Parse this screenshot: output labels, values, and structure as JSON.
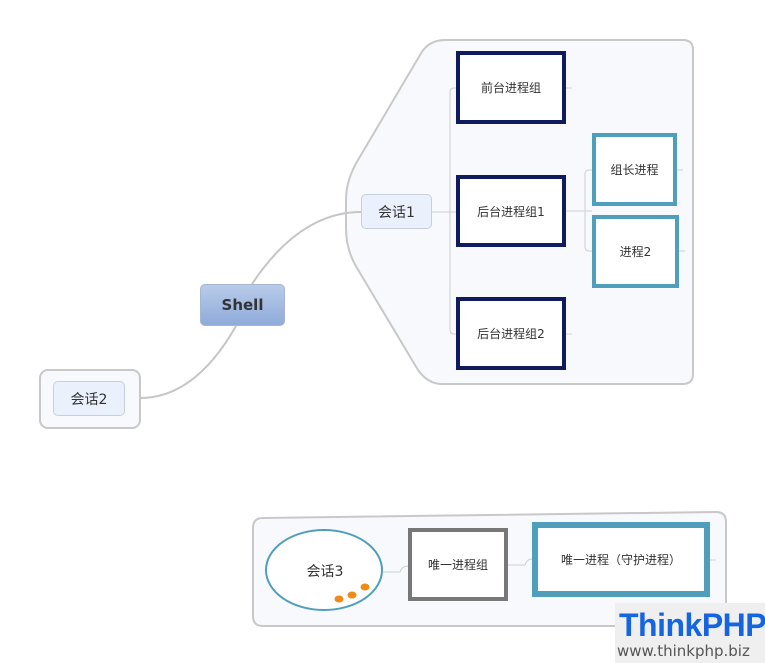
{
  "root": {
    "label": "Shell"
  },
  "sessions": [
    {
      "label": "会话1"
    },
    {
      "label": "会话2"
    },
    {
      "label": "会话3"
    }
  ],
  "session1_groups": [
    {
      "label": "前台进程组"
    },
    {
      "label": "后台进程组1"
    },
    {
      "label": "后台进程组2"
    }
  ],
  "group1_processes": [
    {
      "label": "组长进程"
    },
    {
      "label": "进程2"
    }
  ],
  "session3": {
    "group": "唯一进程组",
    "process": "唯一进程（守护进程）"
  },
  "watermark": {
    "brand": "ThinkPHP",
    "url": "www.thinkphp.biz"
  },
  "colors": {
    "process_group_border": "#101a5e",
    "process_border": "#4f9fbc",
    "single_group_border": "#777777",
    "root_fill": "#9fb7e0",
    "session_fill": "#eaf1fd",
    "marker": "#f28a1a"
  }
}
